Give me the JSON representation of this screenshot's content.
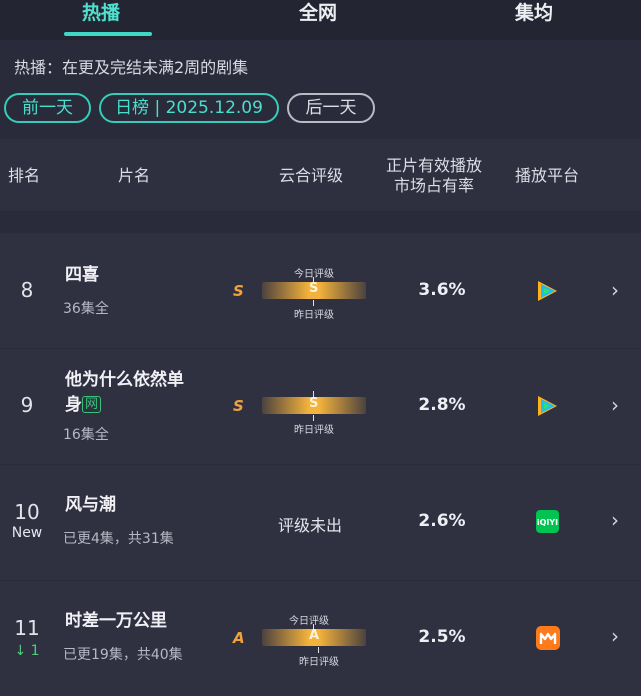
{
  "tabs": [
    {
      "label": "热播",
      "active": true
    },
    {
      "label": "全网",
      "active": false
    },
    {
      "label": "集均",
      "active": false
    }
  ],
  "subtitle": "热播：在更及完结未满2周的剧集",
  "date_nav": {
    "prev": "前一天",
    "current": "日榜 | 2025.12.09",
    "next": "后一天"
  },
  "columns": {
    "rank": "排名",
    "title": "片名",
    "rating": "云合评级",
    "share_line1": "正片有效播放",
    "share_line2": "市场占有率",
    "platform": "播放平台"
  },
  "grade_captions": {
    "today": "今日评级",
    "yesterday": "昨日评级"
  },
  "rows": [
    {
      "rank": "8",
      "rank_sub": "",
      "title_line1": "四喜",
      "title_line2": "",
      "network_badge": "",
      "meta": "36集全",
      "grade_letter": "S",
      "grade_mark": "S",
      "share": "3.6%",
      "platform": "tencent-video-icon"
    },
    {
      "rank": "9",
      "rank_sub": "",
      "title_line1": "他为什么依然单",
      "title_line2": "身",
      "network_badge": "网",
      "meta": "16集全",
      "grade_letter": "S",
      "grade_mark": "S",
      "share": "2.8%",
      "platform": "tencent-video-icon"
    },
    {
      "rank": "10",
      "rank_sub": "New",
      "title_line1": "风与潮",
      "title_line2": "",
      "network_badge": "",
      "meta": "已更4集，共31集",
      "grade_text": "评级未出",
      "share": "2.6%",
      "platform": "iqiyi-icon"
    },
    {
      "rank": "11",
      "rank_sub": "↓ 1",
      "title_line1": "时差一万公里",
      "title_line2": "",
      "network_badge": "",
      "meta": "已更19集，共40集",
      "grade_letter": "A",
      "grade_mark": "A",
      "share": "2.5%",
      "platform": "mango-tv-icon"
    }
  ],
  "colors": {
    "accent": "#3fd8c6",
    "grade": "#f3b23c",
    "tencent": "#1fbcf0",
    "iqiyi": "#00c352",
    "mango": "#ff7a1a"
  }
}
